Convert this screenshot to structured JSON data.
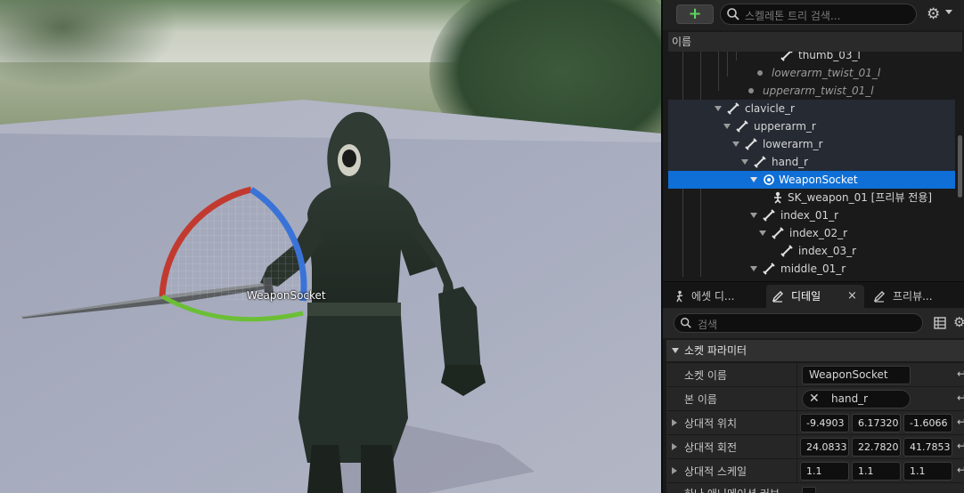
{
  "viewport": {
    "socket_label": "WeaponSocket"
  },
  "skeleton_tree": {
    "add_label": "+",
    "search_placeholder": "스켈레톤 트리 검색...",
    "column_header": "이름",
    "rows": [
      {
        "label": "thumb_03_l",
        "type": "bone",
        "style": "normal"
      },
      {
        "label": "lowerarm_twist_01_l",
        "type": "dot",
        "style": "dim"
      },
      {
        "label": "upperarm_twist_01_l",
        "type": "dot",
        "style": "dim"
      },
      {
        "label": "clavicle_r",
        "type": "bone",
        "style": "shade"
      },
      {
        "label": "upperarm_r",
        "type": "bone",
        "style": "shade"
      },
      {
        "label": "lowerarm_r",
        "type": "bone",
        "style": "shade"
      },
      {
        "label": "hand_r",
        "type": "bone",
        "style": "shade"
      },
      {
        "label": "WeaponSocket",
        "type": "socket",
        "style": "selected"
      },
      {
        "label": "SK_weapon_01 [프리뷰 전용]",
        "type": "mesh",
        "style": "normal"
      },
      {
        "label": "index_01_r",
        "type": "bone",
        "style": "normal"
      },
      {
        "label": "index_02_r",
        "type": "bone",
        "style": "normal"
      },
      {
        "label": "index_03_r",
        "type": "bone",
        "style": "normal"
      },
      {
        "label": "middle_01_r",
        "type": "bone",
        "style": "normal"
      }
    ]
  },
  "tabs": [
    {
      "label": "에셋 디...",
      "active": false
    },
    {
      "label": "디테일",
      "active": true,
      "close": "×"
    },
    {
      "label": "프리뷰...",
      "active": false
    }
  ],
  "details": {
    "search_placeholder": "검색",
    "section_title": "소켓 파라미터",
    "socket_name_label": "소켓 이름",
    "socket_name_value": "WeaponSocket",
    "bone_name_label": "본 이름",
    "bone_name_value": "hand_r",
    "rel_location_label": "상대적 위치",
    "rel_location": [
      "-9.4903",
      "6.17320",
      "-1.6066"
    ],
    "rel_rotation_label": "상대적 회전",
    "rel_rotation": [
      "24.0833",
      "22.7820",
      "41.7853"
    ],
    "rel_scale_label": "상대적 스케일",
    "rel_scale": [
      "1.1",
      "1.1",
      "1.1"
    ],
    "last_row_label": "하나 애니메이션 커브",
    "reset_glyph": "↩"
  }
}
